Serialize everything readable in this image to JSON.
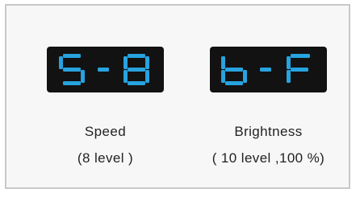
{
  "colors": {
    "segment": "#27a3df",
    "panel": "#121212",
    "frame_border": "#c8c8c8",
    "text": "#222222"
  },
  "displays": [
    {
      "id": "speed",
      "readout": "S-8",
      "label": "Speed",
      "sublabel": "(8 level )"
    },
    {
      "id": "brightness",
      "readout": "b-F",
      "label": "Brightness",
      "sublabel": "( 10 level ,100 %)"
    }
  ]
}
